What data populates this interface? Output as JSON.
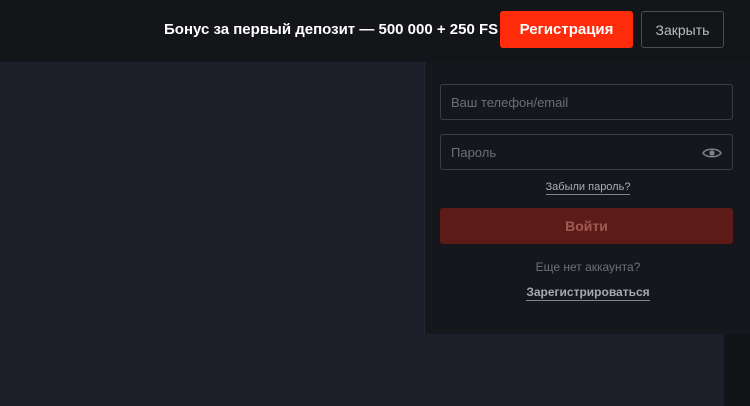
{
  "header": {
    "promo_text": "Бонус за первый депозит — 500 000 + 250 FS",
    "register_label": "Регистрация",
    "close_label": "Закрыть"
  },
  "login": {
    "email_placeholder": "Ваш телефон/email",
    "password_placeholder": "Пароль",
    "forgot_label": "Забыли пароль?",
    "submit_label": "Войти",
    "no_account_text": "Еще нет аккаунта?",
    "signup_label": "Зарегистрироваться",
    "password_toggle_icon": "eye-icon"
  },
  "colors": {
    "accent": "#ff2b0a",
    "login_disabled": "#5e1a17",
    "background": "#1c1f29",
    "panel": "#15171c"
  }
}
